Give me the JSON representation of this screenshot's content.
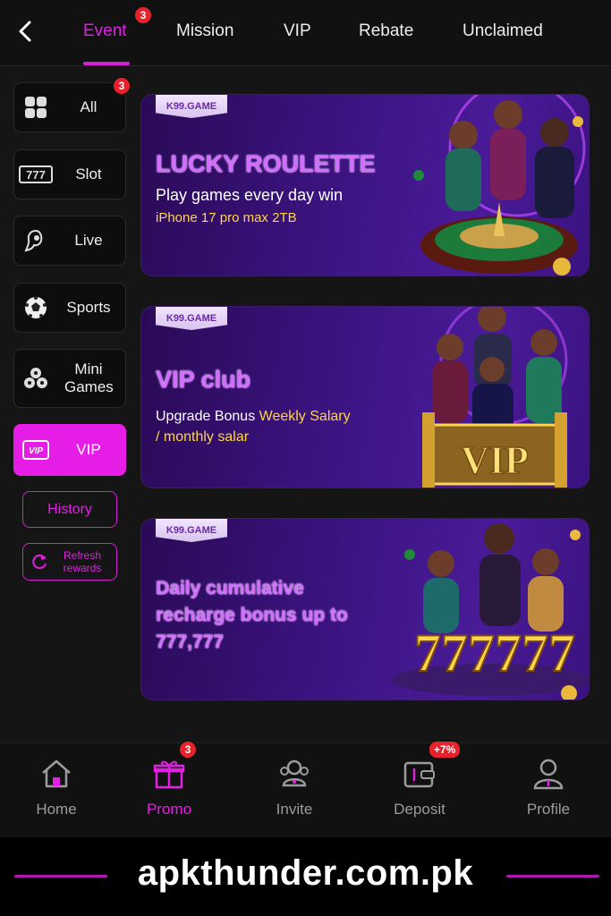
{
  "header": {
    "tabs": [
      {
        "label": "Event",
        "badge": "3",
        "active": true
      },
      {
        "label": "Mission"
      },
      {
        "label": "VIP"
      },
      {
        "label": "Rebate"
      },
      {
        "label": "Unclaimed"
      }
    ]
  },
  "sidebar": {
    "items": [
      {
        "label": "All",
        "icon": "grid-icon",
        "badge": "3"
      },
      {
        "label": "Slot",
        "icon": "slot-777-icon"
      },
      {
        "label": "Live",
        "icon": "live-dealer-icon"
      },
      {
        "label": "Sports",
        "icon": "soccer-ball-icon"
      },
      {
        "label": "Mini Games",
        "icon": "mini-games-icon"
      },
      {
        "label": "VIP",
        "icon": "vip-card-icon",
        "active": true
      }
    ],
    "history_label": "History",
    "refresh_label": "Refresh rewards"
  },
  "banners": [
    {
      "tag": "K99.GAME",
      "title": "LUCKY ROULETTE",
      "subtitle": "Play games every day win",
      "highlight": "iPhone 17 pro max 2TB"
    },
    {
      "tag": "K99.GAME",
      "title": "VIP club",
      "subtitle": "Upgrade Bonus",
      "subtitle_highlight": "Weekly Salary",
      "subtitle_line2": "/ monthly salar",
      "art_text": "VIP"
    },
    {
      "tag": "K99.GAME",
      "title_line1": "Daily cumulative",
      "title_line2": "recharge bonus up to",
      "title_line3": "777,777",
      "art_text": "777777"
    }
  ],
  "bottom_nav": [
    {
      "label": "Home",
      "icon": "home-icon"
    },
    {
      "label": "Promo",
      "icon": "gift-icon",
      "badge": "3",
      "active": true
    },
    {
      "label": "Invite",
      "icon": "invite-users-icon"
    },
    {
      "label": "Deposit",
      "icon": "wallet-icon",
      "badge": "+7%"
    },
    {
      "label": "Profile",
      "icon": "profile-icon"
    }
  ],
  "watermark": "apkthunder.com.pk",
  "colors": {
    "accent": "#e21fe3",
    "badge": "#e8222c",
    "background": "#151516",
    "gold": "#ffd54a"
  }
}
